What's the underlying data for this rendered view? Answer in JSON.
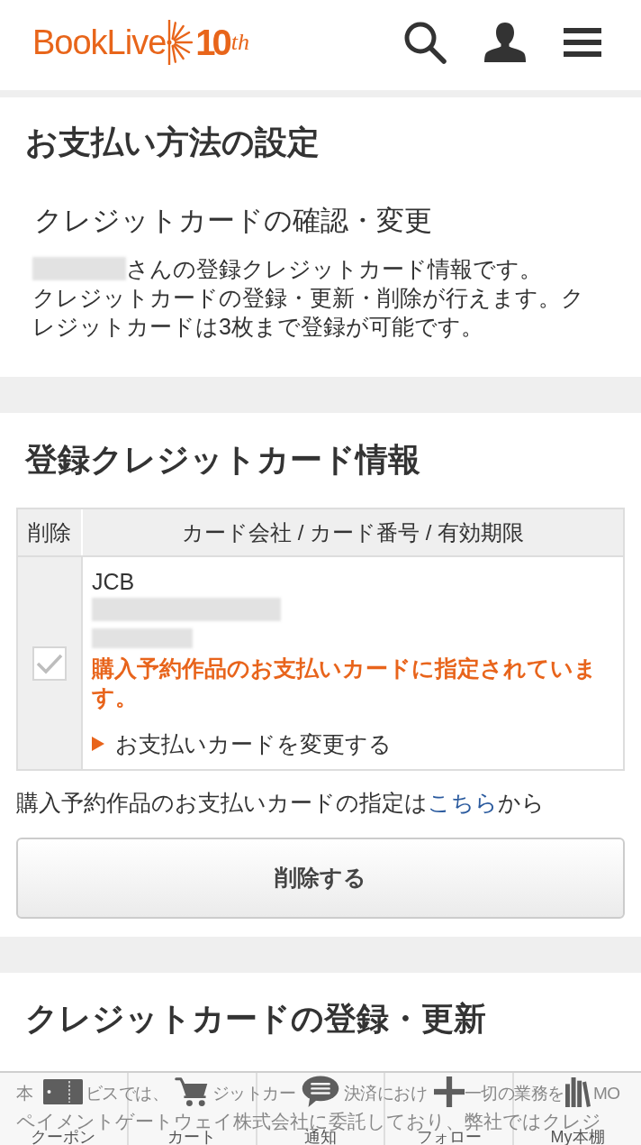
{
  "header": {
    "logo": {
      "brand": "BookLive",
      "number": "10",
      "suffix": "th"
    }
  },
  "payment_settings": {
    "title": "お支払い方法の設定",
    "subtitle": "クレジットカードの確認・変更",
    "intro": "さんの登録クレジットカード情報です。",
    "description": "クレジットカードの登録・更新・削除が行えます。クレジットカードは3枚まで登録が可能です。"
  },
  "registered_cards": {
    "title": "登録クレジットカード情報",
    "columns": [
      "削除",
      "カード会社 / カード番号 / 有効期限"
    ],
    "rows": [
      {
        "checked": true,
        "disabled": true,
        "company": "JCB",
        "notice": "購入予約作品のお支払いカードに指定されています。",
        "action": "お支払いカードを変更する"
      }
    ],
    "note": {
      "before": "購入予約作品のお支払いカードの指定は",
      "link": "こちら",
      "after": "から"
    },
    "delete_button": "削除する"
  },
  "card_registration": {
    "title": "クレジットカードの登録・更新",
    "notice": {
      "first_line_parts": [
        "本",
        "ビスでは、",
        "ジットカー",
        "決済におけ",
        "一切の業務を",
        "MO"
      ],
      "second_line": "ペイメントゲートウェイ株式会社に委託しており、弊社ではクレジ"
    }
  },
  "bottom_nav": [
    {
      "label": "クーポン"
    },
    {
      "label": "カート"
    },
    {
      "label": "通知"
    },
    {
      "label": "フォロー"
    },
    {
      "label": "My本棚"
    }
  ]
}
